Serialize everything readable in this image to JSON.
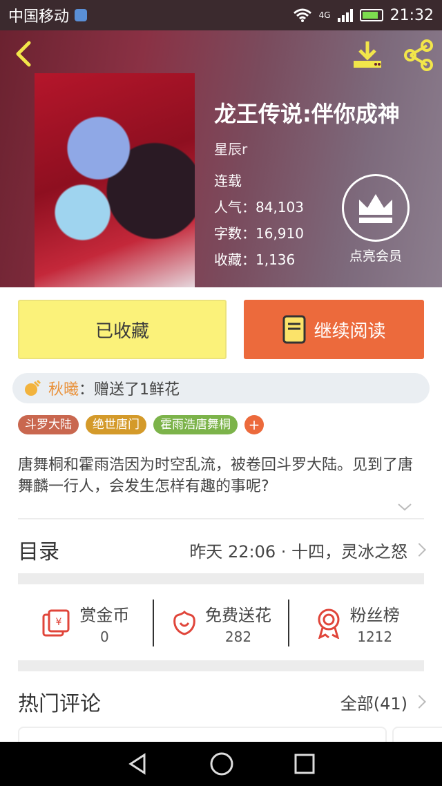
{
  "status_bar": {
    "carrier": "中国移动",
    "network": "4G",
    "time": "21:32"
  },
  "book": {
    "title": "龙王传说:伴你成神",
    "author": "星辰r",
    "status": "连载",
    "popularity": "人气：84,103",
    "words": "字数：16,910",
    "favorites": "收藏：1,136",
    "vip_label": "点亮会员"
  },
  "actions": {
    "collected_label": "已收藏",
    "continue_label": "继续阅读"
  },
  "gift": {
    "user": "秋曦",
    "text": "：赠送了1鲜花"
  },
  "tags": [
    {
      "label": "斗罗大陆",
      "color": "#c9674f"
    },
    {
      "label": "绝世唐门",
      "color": "#d49a2a"
    },
    {
      "label": "霍雨浩唐舞桐",
      "color": "#7cb34a"
    }
  ],
  "tag_add": "+",
  "description": "唐舞桐和霍雨浩因为时空乱流，被卷回斗罗大陆。见到了唐舞麟一行人，会发生怎样有趣的事呢?",
  "toc": {
    "title": "目录",
    "latest": "昨天 22:06 · 十四，灵冰之怒"
  },
  "stats": {
    "reward": {
      "label": "赏金币",
      "value": "0"
    },
    "flowers": {
      "label": "免费送花",
      "value": "282"
    },
    "fans": {
      "label": "粉丝榜",
      "value": "1212"
    }
  },
  "hot_comments": {
    "title": "热门评论",
    "all": "全部(41)"
  },
  "colors": {
    "accent_orange": "#ec6a3c",
    "accent_yellow": "#fbf27a",
    "icon_red": "#e0453a"
  }
}
